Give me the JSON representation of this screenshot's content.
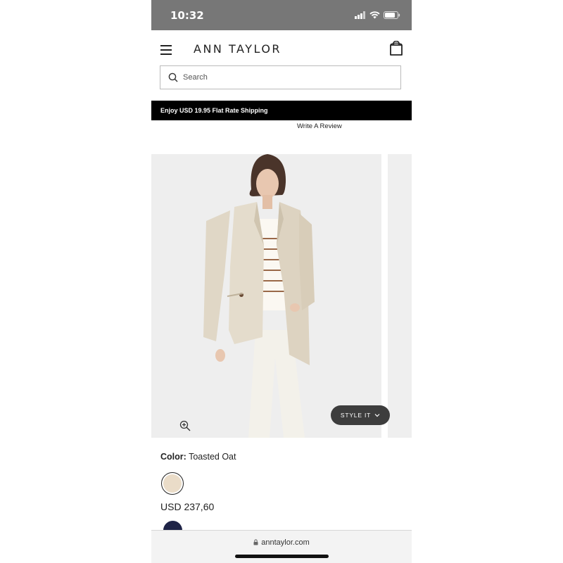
{
  "status_bar": {
    "time": "10:32"
  },
  "header": {
    "brand": "ANN TAYLOR",
    "search_placeholder": "Search"
  },
  "promo_banner": {
    "text": "Enjoy USD 19.95 Flat Rate Shipping"
  },
  "reviews": {
    "write_review_label": "Write A Review"
  },
  "product": {
    "style_it_label": "STYLE IT",
    "color_label": "Color:",
    "color_value": "Toasted Oat",
    "price": "USD 237,60",
    "swatches": [
      {
        "name": "Toasted Oat",
        "hex": "#eadcc8",
        "selected": true
      },
      {
        "name": "navy",
        "hex": "#1f2447",
        "selected": false
      }
    ]
  },
  "browser": {
    "url": "anntaylor.com"
  },
  "colors": {
    "promo_bg": "#000000",
    "status_bar_bg": "#777777",
    "style_it_bg": "#3d3d3d"
  }
}
